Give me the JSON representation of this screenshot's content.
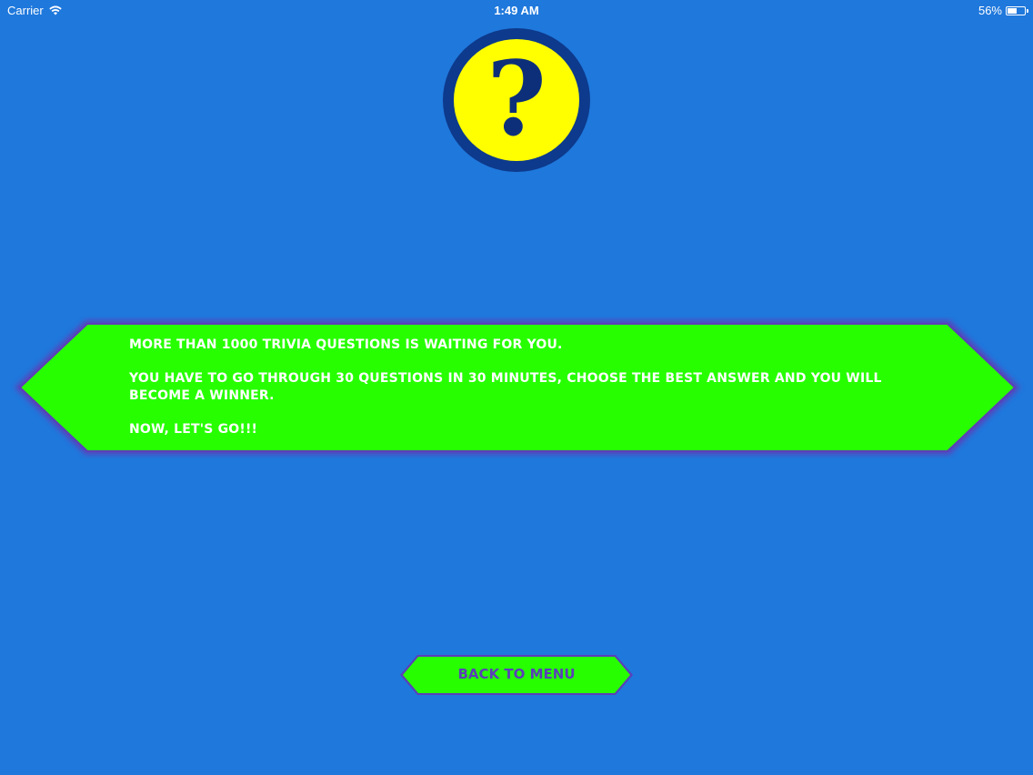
{
  "status_bar": {
    "carrier": "Carrier",
    "time": "1:49 AM",
    "battery_percent": "56%",
    "battery_level": 0.56,
    "wifi_icon": "wifi-icon",
    "battery_icon": "battery-icon"
  },
  "logo": {
    "icon": "question-mark-icon",
    "glyph": "?",
    "colors": {
      "fill": "#ffff00",
      "ring": "#0d3a8c",
      "glyph": "#0d2f7a"
    }
  },
  "info": {
    "line1": "MORE THAN 1000 TRIVIA QUESTIONS IS WAITING FOR YOU.",
    "line2": "YOU HAVE TO GO THROUGH 30 QUESTIONS IN 30 MINUTES, CHOOSE THE BEST ANSWER AND YOU WILL BECOME A WINNER.",
    "line3": "NOW, LET'S GO!!!"
  },
  "back_button": {
    "label": "BACK TO MENU"
  },
  "colors": {
    "background": "#1f78dc",
    "banner_fill": "#27ff00",
    "banner_border": "#5b3fb8",
    "button_text": "#5b3fb8"
  }
}
